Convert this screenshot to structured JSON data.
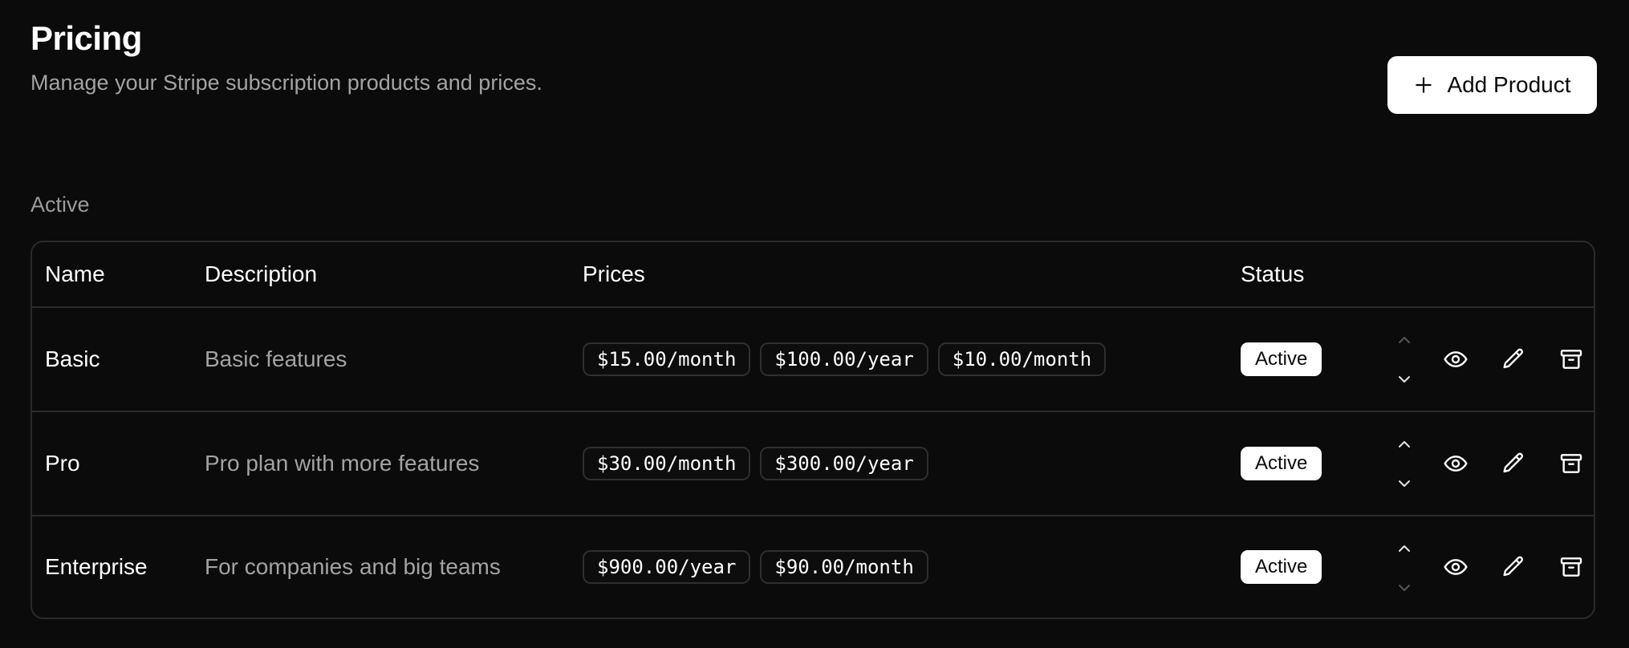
{
  "header": {
    "title": "Pricing",
    "subtitle": "Manage your Stripe subscription products and prices.",
    "add_button_label": "Add Product"
  },
  "section": {
    "label": "Active"
  },
  "table": {
    "columns": {
      "name": "Name",
      "description": "Description",
      "prices": "Prices",
      "status": "Status"
    },
    "rows": [
      {
        "name": "Basic",
        "description": "Basic features",
        "prices": [
          "$15.00/month",
          "$100.00/year",
          "$10.00/month"
        ],
        "status": "Active",
        "move_up_enabled": false,
        "move_down_enabled": true
      },
      {
        "name": "Pro",
        "description": "Pro plan with more features",
        "prices": [
          "$30.00/month",
          "$300.00/year"
        ],
        "status": "Active",
        "move_up_enabled": true,
        "move_down_enabled": true
      },
      {
        "name": "Enterprise",
        "description": "For companies and big teams",
        "prices": [
          "$900.00/year",
          "$90.00/month"
        ],
        "status": "Active",
        "move_up_enabled": true,
        "move_down_enabled": false
      }
    ]
  },
  "icons": {
    "add": "plus-icon",
    "move_up": "chevron-up-icon",
    "move_down": "chevron-down-icon",
    "view": "eye-icon",
    "edit": "pencil-icon",
    "archive": "archive-icon"
  },
  "colors": {
    "background": "#0b0b0b",
    "border": "#2a2a2a",
    "muted_text": "#a3a3a3",
    "badge_bg": "#ffffff"
  }
}
